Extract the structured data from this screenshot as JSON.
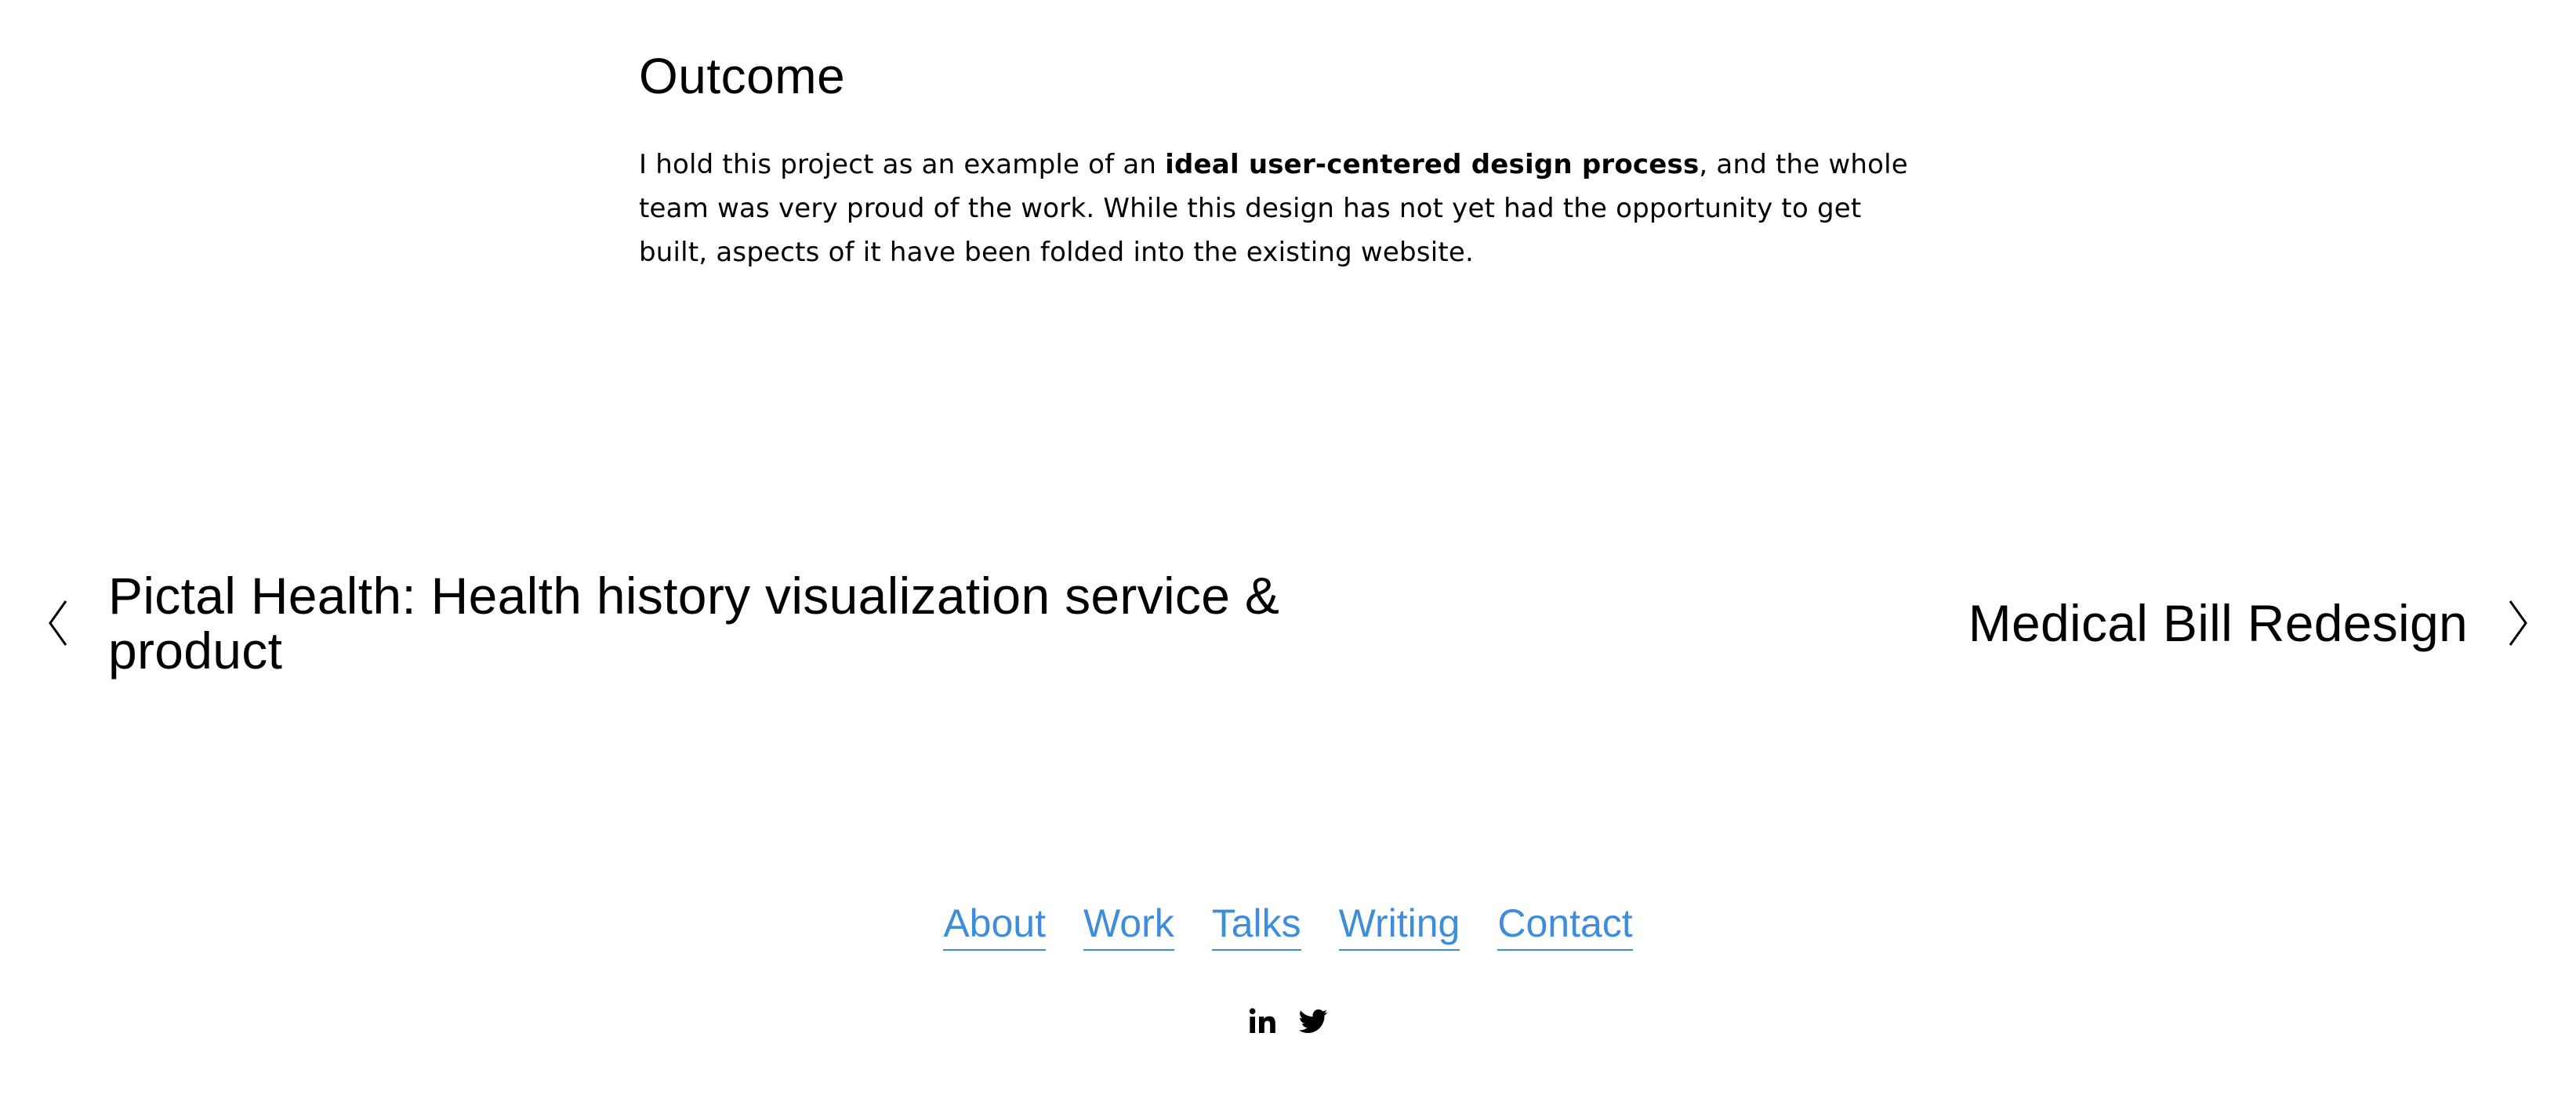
{
  "outcome": {
    "heading": "Outcome",
    "body_pre": "I hold this project as an example of an ",
    "body_bold": "ideal user-centered design process",
    "body_post": ", and the whole team was very proud of the work. While this design has not yet had the opportunity to get built, aspects of it have been folded into the existing website."
  },
  "pager": {
    "prev_title": "Pictal Health: Health history visualization service & product",
    "prev_icon": "chevron-left-icon",
    "next_title": "Medical Bill Redesign",
    "next_icon": "chevron-right-icon"
  },
  "footer": {
    "links": [
      "About",
      "Work",
      "Talks",
      "Writing",
      "Contact"
    ],
    "link_color": "#3e8ddd"
  },
  "social": {
    "icons": [
      "linkedin-icon",
      "twitter-icon"
    ]
  }
}
